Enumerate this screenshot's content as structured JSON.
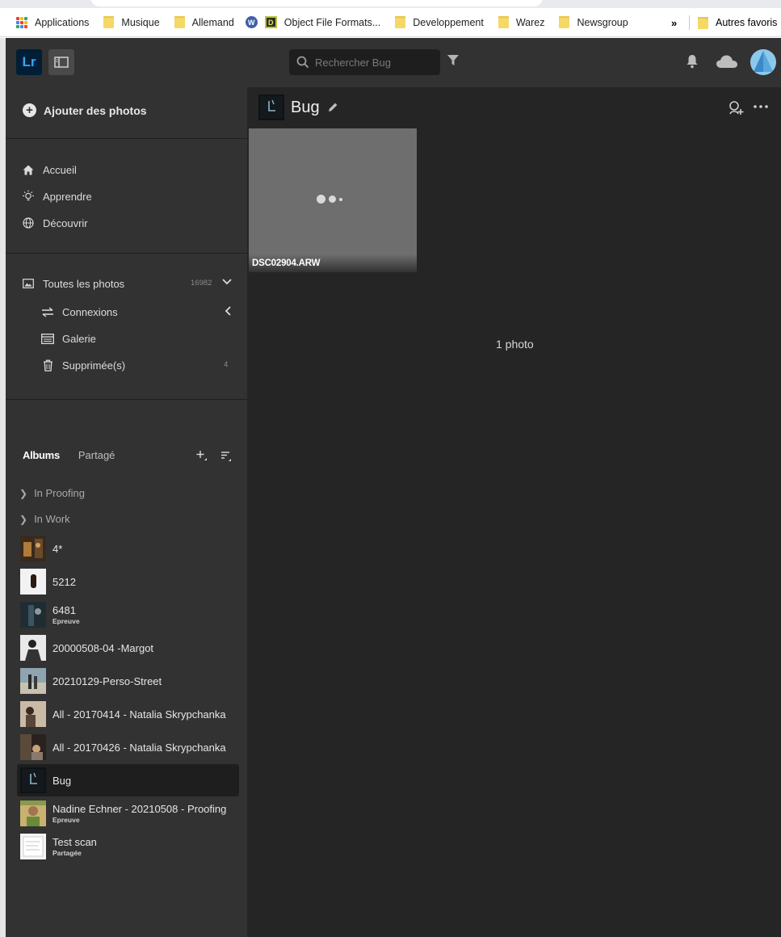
{
  "bookmarks": {
    "items": [
      {
        "label": "Applications",
        "icon": "apps-grid-icon"
      },
      {
        "label": "Musique",
        "icon": "folder-icon"
      },
      {
        "label": "Allemand",
        "icon": "folder-icon"
      },
      {
        "label": "Object File Formats...",
        "icon": "d-site-icon"
      },
      {
        "label": "Developpement",
        "icon": "folder-icon"
      },
      {
        "label": "Warez",
        "icon": "folder-icon"
      },
      {
        "label": "Newsgroup",
        "icon": "folder-icon"
      }
    ],
    "overflow": "»",
    "other": "Autres favoris"
  },
  "topbar": {
    "logo": "Lr",
    "search_placeholder": "Rechercher Bug"
  },
  "sidebar": {
    "add_photos": "Ajouter des photos",
    "nav": [
      {
        "label": "Accueil",
        "icon": "home-icon"
      },
      {
        "label": "Apprendre",
        "icon": "lightbulb-icon"
      },
      {
        "label": "Découvrir",
        "icon": "globe-icon"
      }
    ],
    "library": {
      "all_photos": {
        "label": "Toutes les photos",
        "count": "16982"
      },
      "connections": {
        "label": "Connexions"
      },
      "gallery": {
        "label": "Galerie"
      },
      "deleted": {
        "label": "Supprimée(s)",
        "count": "4"
      }
    },
    "tabs": {
      "albums": "Albums",
      "shared": "Partagé"
    },
    "folders": [
      {
        "label": "In Proofing"
      },
      {
        "label": "In Work"
      }
    ],
    "albums": [
      {
        "name": "4*",
        "sub": ""
      },
      {
        "name": "5212",
        "sub": ""
      },
      {
        "name": "6481",
        "sub": "Epreuve"
      },
      {
        "name": "20000508-04 -Margot",
        "sub": ""
      },
      {
        "name": "20210129-Perso-Street",
        "sub": ""
      },
      {
        "name": "All - 20170414 - Natalia Skrypchanka",
        "sub": ""
      },
      {
        "name": "All - 20170426 - Natalia Skrypchanka",
        "sub": ""
      },
      {
        "name": "Bug",
        "sub": ""
      },
      {
        "name": "Nadine Echner - 20210508 - Proofing",
        "sub": "Epreuve"
      },
      {
        "name": "Test scan",
        "sub": "Partagée"
      }
    ]
  },
  "main": {
    "album_title": "Bug",
    "photo": {
      "filename": "DSC02904.ARW"
    },
    "photo_count": "1 photo"
  },
  "colors": {
    "app_bg": "#252525",
    "panel_bg": "#323232",
    "accent": "#31a8ff"
  }
}
